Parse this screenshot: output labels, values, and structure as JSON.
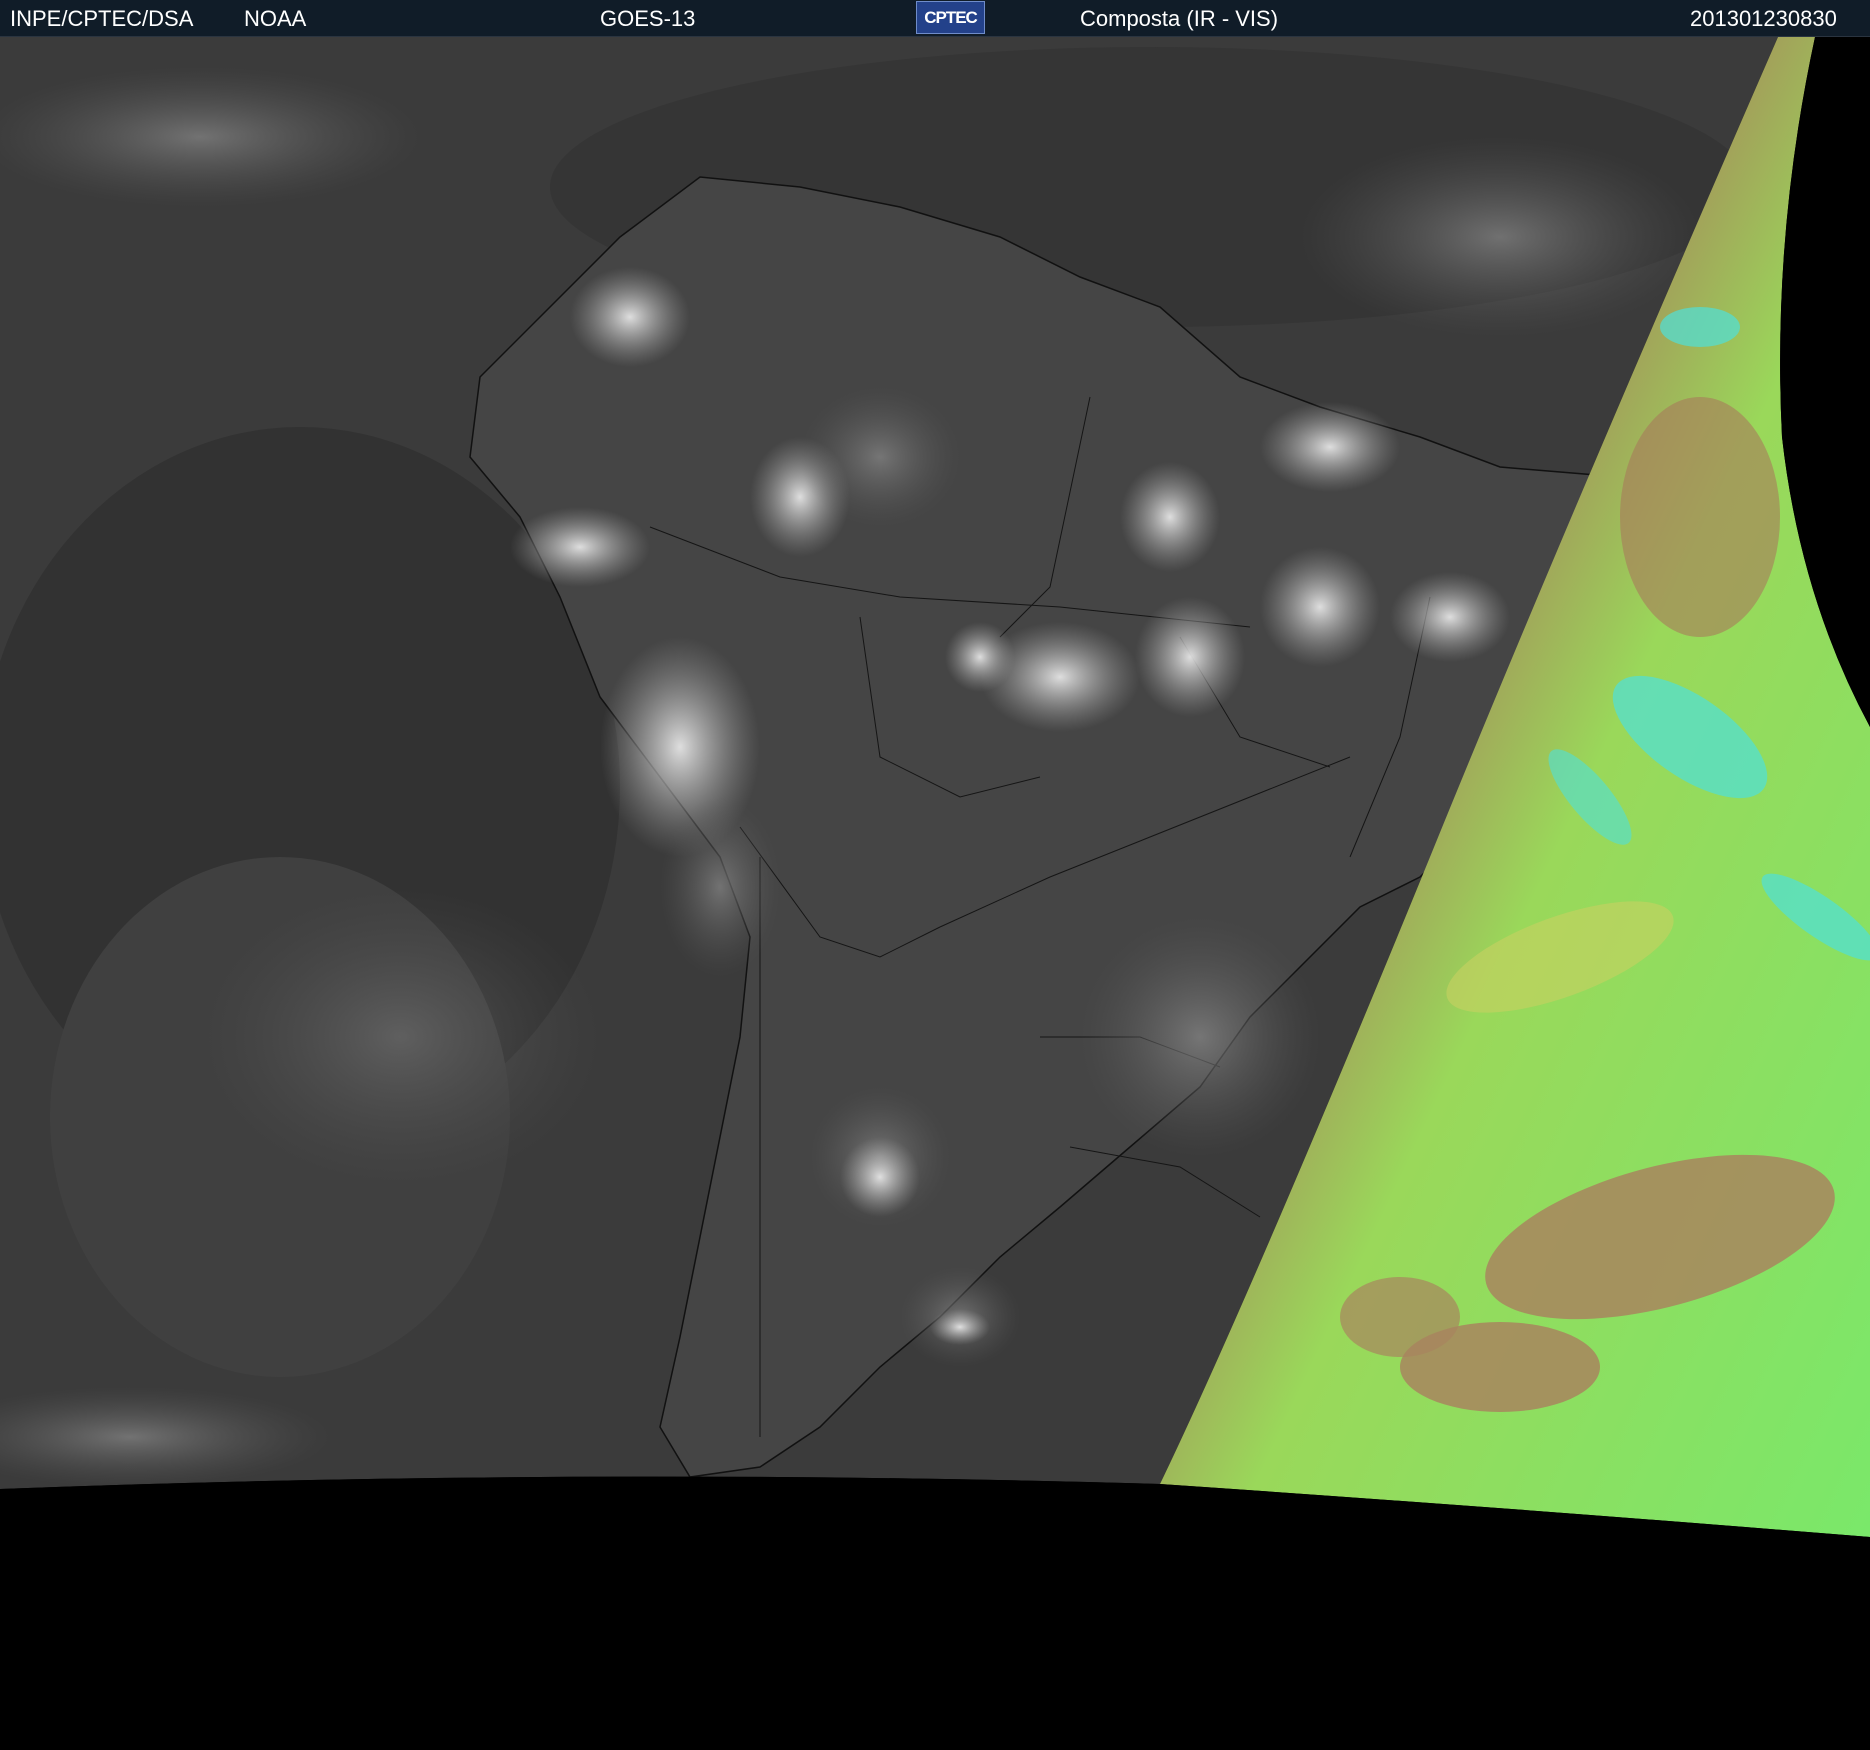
{
  "header": {
    "agency": "INPE/CPTEC/DSA",
    "partner": "NOAA",
    "satellite": "GOES-13",
    "logo_text": "CPTEC",
    "product": "Composta (IR - VIS)",
    "timestamp": "201301230830"
  },
  "map": {
    "colors": {
      "ocean_gray": "#3a3a3a",
      "cloud_white": "#d8d8d8",
      "vis_green": "#7ae86a",
      "vis_brown": "#a8855e",
      "vis_cyan": "#4fe0d8",
      "no_data": "#000000"
    }
  }
}
